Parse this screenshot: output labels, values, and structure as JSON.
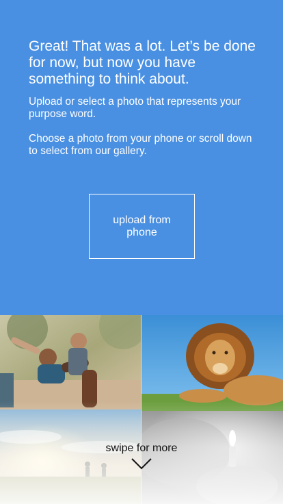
{
  "intro": {
    "headline": "Great! That was a lot. Let’s be done for now, but now you have something to think about.",
    "paragraph1": "Upload or select a photo that represents your purpose word.",
    "paragraph2": "Choose a photo from your phone or scroll down to select from our gallery."
  },
  "upload": {
    "label": "upload from phone"
  },
  "gallery": {
    "photos": [
      "family-photo",
      "lion-photo",
      "sunset-field-photo",
      "candle-photo"
    ]
  },
  "swipe": {
    "label": "swipe for more",
    "icon": "chevron-down-icon"
  },
  "colors": {
    "background": "#4a90e2",
    "text": "#ffffff"
  }
}
